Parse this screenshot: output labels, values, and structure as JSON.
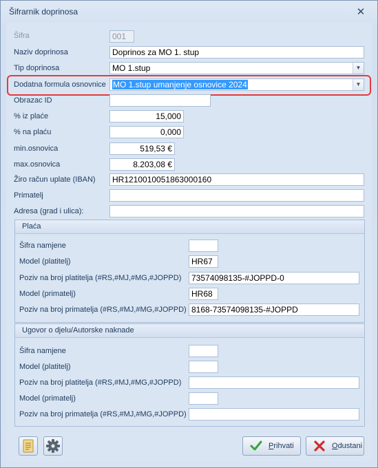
{
  "window": {
    "title": "Šifrarnik doprinosa",
    "close_glyph": "✕"
  },
  "form": {
    "sifra": {
      "label": "Šifra",
      "value": "001"
    },
    "naziv": {
      "label": "Naziv doprinosa",
      "value": "Doprinos za MO 1. stup"
    },
    "tip": {
      "label": "Tip doprinosa",
      "value": "MO 1.stup"
    },
    "dodatna": {
      "label": "Dodatna formula osnovnice",
      "value": "MO 1.stup umanjenje osnovice 2024"
    },
    "obrazac": {
      "label": "Obrazac ID",
      "value": ""
    },
    "iz_place": {
      "label": "% iz plaće",
      "value": "15,000"
    },
    "na_placu": {
      "label": "% na plaću",
      "value": "0,000"
    },
    "min_osnovica": {
      "label": "min.osnovica",
      "value": "519,53 €"
    },
    "max_osnovica": {
      "label": "max.osnovica",
      "value": "8.203,08 €"
    },
    "iban": {
      "label": "Žiro račun uplate (IBAN)",
      "value": "HR1210010051863000160"
    },
    "primatelj": {
      "label": "Primatelj",
      "value": ""
    },
    "adresa": {
      "label": "Adresa (grad i ulica):",
      "value": ""
    }
  },
  "group_placa": {
    "title": "Plaća",
    "sifra_namjene": {
      "label": "Šifra namjene",
      "value": ""
    },
    "model_platitelj": {
      "label": "Model (platitelj)",
      "value": "HR67"
    },
    "poziv_platitelja": {
      "label": "Poziv na broj platitelja (#RS,#MJ,#MG,#JOPPD)",
      "value": "73574098135-#JOPPD-0"
    },
    "model_primatelj": {
      "label": "Model (primatelj)",
      "value": "HR68"
    },
    "poziv_primatelja": {
      "label": "Poziv na broj primatelja (#RS,#MJ,#MG,#JOPPD)",
      "value": "8168-73574098135-#JOPPD"
    }
  },
  "group_ugovor": {
    "title": "Ugovor o djelu/Autorske naknade",
    "sifra_namjene": {
      "label": "Šifra namjene",
      "value": ""
    },
    "model_platitelj": {
      "label": "Model (platitelj)",
      "value": ""
    },
    "poziv_platitelja": {
      "label": "Poziv na broj platitelja (#RS,#MJ,#MG,#JOPPD)",
      "value": ""
    },
    "model_primatelj": {
      "label": "Model (primatelj)",
      "value": ""
    },
    "poziv_primatelja": {
      "label": "Poziv na broj primatelja (#RS,#MJ,#MG,#JOPPD)",
      "value": ""
    }
  },
  "footer": {
    "report_icon": "document-report-icon",
    "settings_icon": "gear-icon",
    "accept": {
      "prefix": "",
      "underline": "P",
      "rest": "rihvati",
      "icon": "check-icon",
      "icon_color": "#3aa33a"
    },
    "cancel": {
      "prefix": "",
      "underline": "O",
      "rest": "dustani",
      "icon": "close-x-icon",
      "icon_color": "#d22b2b"
    }
  },
  "colors": {
    "highlight_border": "#e43a3a",
    "selection": "#3399ff"
  }
}
